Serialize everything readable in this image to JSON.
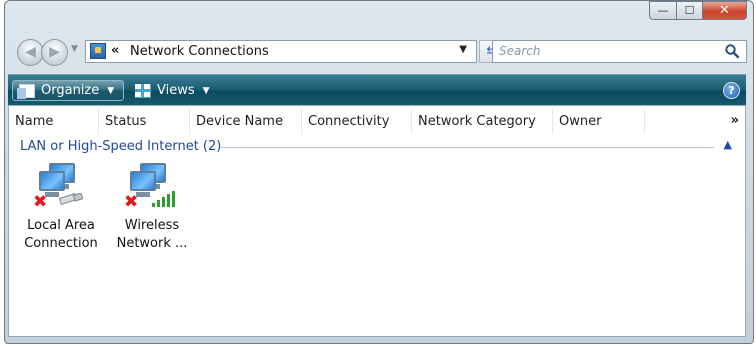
{
  "window": {
    "caption": {
      "minimize": "—",
      "maximize": "☐",
      "close": "✕"
    }
  },
  "address_bar": {
    "chevron": "«",
    "path": "Network Connections"
  },
  "search": {
    "placeholder": "Search"
  },
  "toolbar": {
    "organize_label": "Organize",
    "views_label": "Views",
    "help_glyph": "?"
  },
  "columns": [
    "Name",
    "Status",
    "Device Name",
    "Connectivity",
    "Network Category",
    "Owner"
  ],
  "more_columns": "»",
  "group": {
    "label": "LAN or High-Speed Internet (2)"
  },
  "items": [
    {
      "line1": "Local Area",
      "line2": "Connection",
      "icon": "lan-disconnected-icon"
    },
    {
      "line1": "Wireless",
      "line2": "Network ...",
      "icon": "wireless-disconnected-icon"
    }
  ],
  "colors": {
    "toolbar": "#195c72",
    "group_text": "#1f4aa0",
    "disconnected": "#e01b1b",
    "signal": "#2f9e2f"
  }
}
